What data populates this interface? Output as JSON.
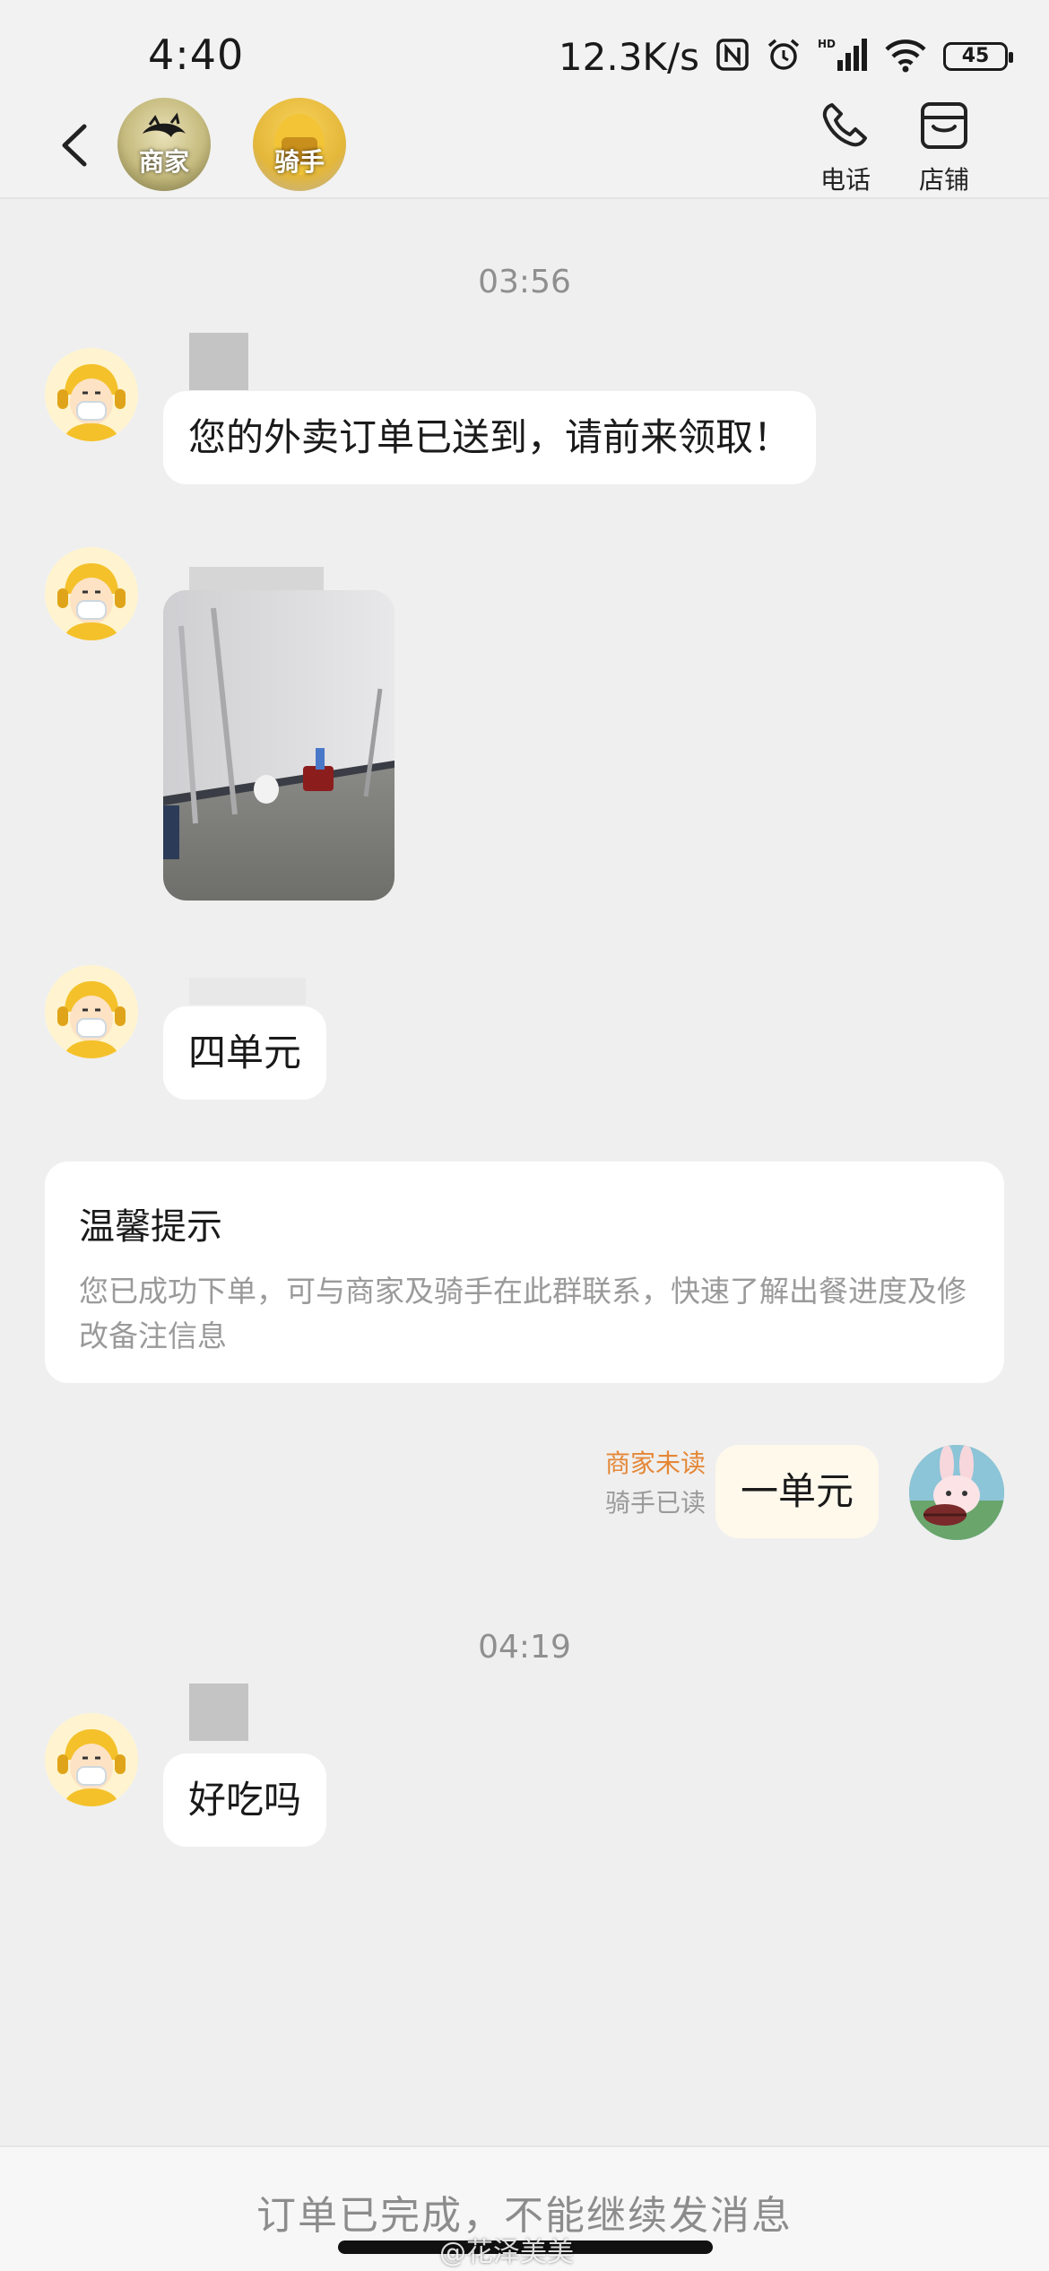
{
  "status_bar": {
    "time": "4:40",
    "net_speed": "12.3K/s",
    "battery": "45"
  },
  "header": {
    "merchant_label": "商家",
    "rider_label": "骑手",
    "phone_label": "电话",
    "shop_label": "店铺"
  },
  "messages": [
    {
      "time": "03:56"
    },
    {
      "text": "您的外卖订单已送到，请前来领取！"
    },
    {
      "text": "四单元"
    },
    {
      "text": "一单元",
      "merchant_status": "商家未读",
      "rider_status": "骑手已读"
    },
    {
      "time": "04:19"
    },
    {
      "text": "好吃吗"
    }
  ],
  "tip": {
    "title": "温馨提示",
    "body": "您已成功下单，可与商家及骑手在此群联系，快速了解出餐进度及修改备注信息"
  },
  "footer": {
    "text": "订单已完成，不能继续发消息",
    "watermark": "@花泽美美"
  },
  "colors": {
    "background": "#efefef",
    "bubble": "#ffffff",
    "my_bubble": "#fff9ec",
    "unread": "#e58736"
  }
}
